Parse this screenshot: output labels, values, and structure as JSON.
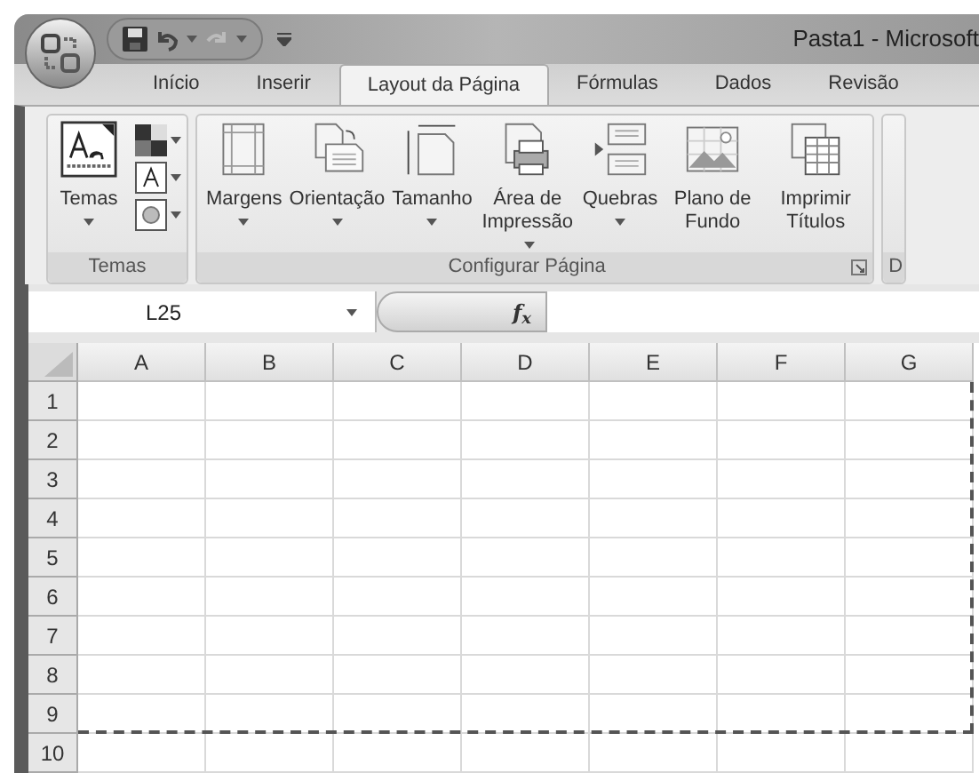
{
  "window": {
    "title": "Pasta1 - Microsoft"
  },
  "tabs": [
    {
      "label": "Início",
      "selected": false
    },
    {
      "label": "Inserir",
      "selected": false
    },
    {
      "label": "Layout da Página",
      "selected": true
    },
    {
      "label": "Fórmulas",
      "selected": false
    },
    {
      "label": "Dados",
      "selected": false
    },
    {
      "label": "Revisão",
      "selected": false
    }
  ],
  "ribbon": {
    "groups": [
      {
        "label": "Temas",
        "kind": "themes",
        "buttons": [
          {
            "label": "Temas",
            "kind": "themes",
            "has_menu": true
          }
        ]
      },
      {
        "label": "Configurar Página",
        "kind": "page",
        "dialog_launcher": true,
        "buttons": [
          {
            "label": "Margens",
            "kind": "margins",
            "has_menu": true
          },
          {
            "label": "Orientação",
            "kind": "orientation",
            "has_menu": true
          },
          {
            "label": "Tamanho",
            "kind": "size",
            "has_menu": true
          },
          {
            "label": "Área de Impressão",
            "kind": "print_area",
            "has_menu": true
          },
          {
            "label": "Quebras",
            "kind": "breaks",
            "has_menu": true
          },
          {
            "label": "Plano de Fundo",
            "kind": "background",
            "has_menu": false
          },
          {
            "label": "Imprimir Títulos",
            "kind": "print_titles",
            "has_menu": false
          }
        ]
      },
      {
        "label": "D",
        "kind": "partial"
      }
    ]
  },
  "formula_bar": {
    "name_box": "L25",
    "function_label": "f$_{x}$"
  },
  "sheet": {
    "columns": [
      {
        "label": "A",
        "page_break": false
      },
      {
        "label": "B",
        "page_break": false
      },
      {
        "label": "C",
        "page_break": false
      },
      {
        "label": "D",
        "page_break": false
      },
      {
        "label": "E",
        "page_break": false
      },
      {
        "label": "F",
        "page_break": false
      },
      {
        "label": "G",
        "page_break": true
      }
    ],
    "rows": [
      {
        "label": "1",
        "page_break": false
      },
      {
        "label": "2",
        "page_break": false
      },
      {
        "label": "3",
        "page_break": false
      },
      {
        "label": "4",
        "page_break": false
      },
      {
        "label": "5",
        "page_break": false
      },
      {
        "label": "6",
        "page_break": false
      },
      {
        "label": "7",
        "page_break": false
      },
      {
        "label": "8",
        "page_break": false
      },
      {
        "label": "9",
        "page_break": true
      },
      {
        "label": "10",
        "page_break": false
      }
    ]
  }
}
